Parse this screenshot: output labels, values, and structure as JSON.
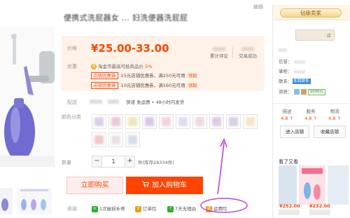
{
  "header": {
    "edit_link": "编辑",
    "title": "便携式洗屁器女 ... 妇洗便器洗屁屁"
  },
  "price": {
    "label": "价格",
    "value": "¥25.00-33.00",
    "reviews_label": "累计评论",
    "sales_label": "交易成功"
  },
  "promo": {
    "label": "优惠",
    "coin_icon": "淘",
    "coin_text": "淘金币最高可抵商品价",
    "coin_rate": "5%",
    "coupons": [
      {
        "tag": "店铺优惠券",
        "text": "15元店铺优惠券，满250元可用",
        "action": "领取"
      },
      {
        "tag": "店铺优惠券",
        "text": "10元店铺优惠券，满160元可用",
        "action": "领取"
      }
    ]
  },
  "shipping": {
    "label": "配送",
    "text": "快递  免运费  •  48小时内发货"
  },
  "color": {
    "label": "颜色分类",
    "swatches": [
      "#dcd0e8",
      "#e8c8d8",
      "#f0e6c0",
      "#d8c8e4",
      "#f4d4dc",
      "#e0dcf0",
      "#f0d8e0",
      "#dccce8",
      "#d8d0e4",
      "#f8e4c8",
      "#f0c8c8",
      "#e8e0e4",
      "#d4dcec"
    ]
  },
  "quantity": {
    "label": "数量",
    "minus": "−",
    "value": "1",
    "plus": "+",
    "stock": "件(库存28334件)"
  },
  "actions": {
    "buy_now": "立即购买",
    "add_to_cart": "加入购物车"
  },
  "promises": {
    "label": "承诺",
    "items": [
      {
        "icon": "V",
        "text": "1次破损补寄",
        "color": "#2db12d"
      },
      {
        "icon": "Y",
        "text": "订单险",
        "color": "#f29c1f"
      },
      {
        "icon": "7",
        "text": "7天无理由",
        "color": "#2db12d"
      },
      {
        "icon": "运",
        "text": "运费险",
        "color": "#f29c1f"
      }
    ]
  },
  "seller": {
    "badge": "钻级卖家",
    "shop_suffix": "店",
    "reputation_label": "信誉：",
    "wangwang_label": "掌柜：",
    "contact_label": "联系：",
    "contact_tag": "和我联系",
    "qualification_label": "资质：",
    "deposit_tag": "1000元",
    "scores": [
      {
        "label": "描述",
        "value": "4.8 ↑"
      },
      {
        "label": "服务",
        "value": "4.8 ↑"
      },
      {
        "label": "物流",
        "value": "4.8 ↑"
      }
    ],
    "enter_shop": "进入店铺",
    "favorite_shop": "收藏店铺"
  },
  "also_viewed": {
    "title": "看了又看",
    "items": [
      {
        "price": "¥252.00",
        "color": "#d9e4ef"
      },
      {
        "price": "¥232.00",
        "color": "#f5c9d2"
      },
      {
        "price": "",
        "color": "#e4ecf4"
      }
    ]
  },
  "colors": {
    "accent": "#ff4400",
    "price_bg": "#fff2e8",
    "annotation": "#c040e0"
  }
}
